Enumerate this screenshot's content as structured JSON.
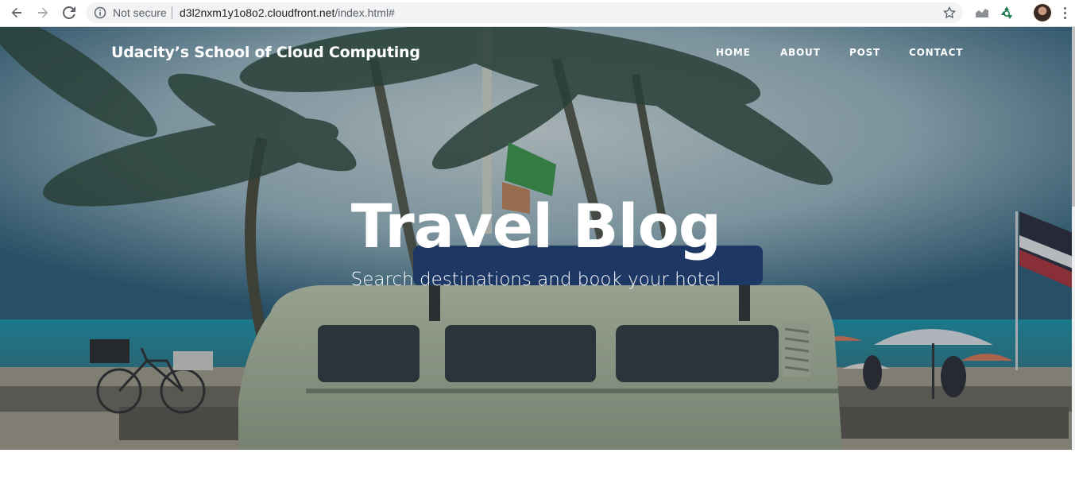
{
  "browser": {
    "security_text": "Not secure",
    "url_host": "d3l2nxm1y1o8o2.cloudfront.net",
    "url_path": "/index.html#",
    "icons": [
      "back-arrow-icon",
      "forward-arrow-icon",
      "reload-icon",
      "info-icon",
      "star-icon",
      "extension-chart-icon",
      "extension-recycle-icon",
      "avatar",
      "menu-dots-icon"
    ]
  },
  "site": {
    "brand": "Udacity’s School of Cloud Computing",
    "nav": [
      {
        "label": "HOME"
      },
      {
        "label": "ABOUT"
      },
      {
        "label": "POST"
      },
      {
        "label": "CONTACT"
      }
    ],
    "hero": {
      "title": "Travel Blog",
      "subtitle": "Search destinations and book your hotel"
    }
  },
  "colors": {
    "chrome_bg": "#ffffff",
    "omnibox_bg": "#f1f3f4",
    "hero_text": "#ffffff",
    "sea": "#1f8aa0"
  }
}
